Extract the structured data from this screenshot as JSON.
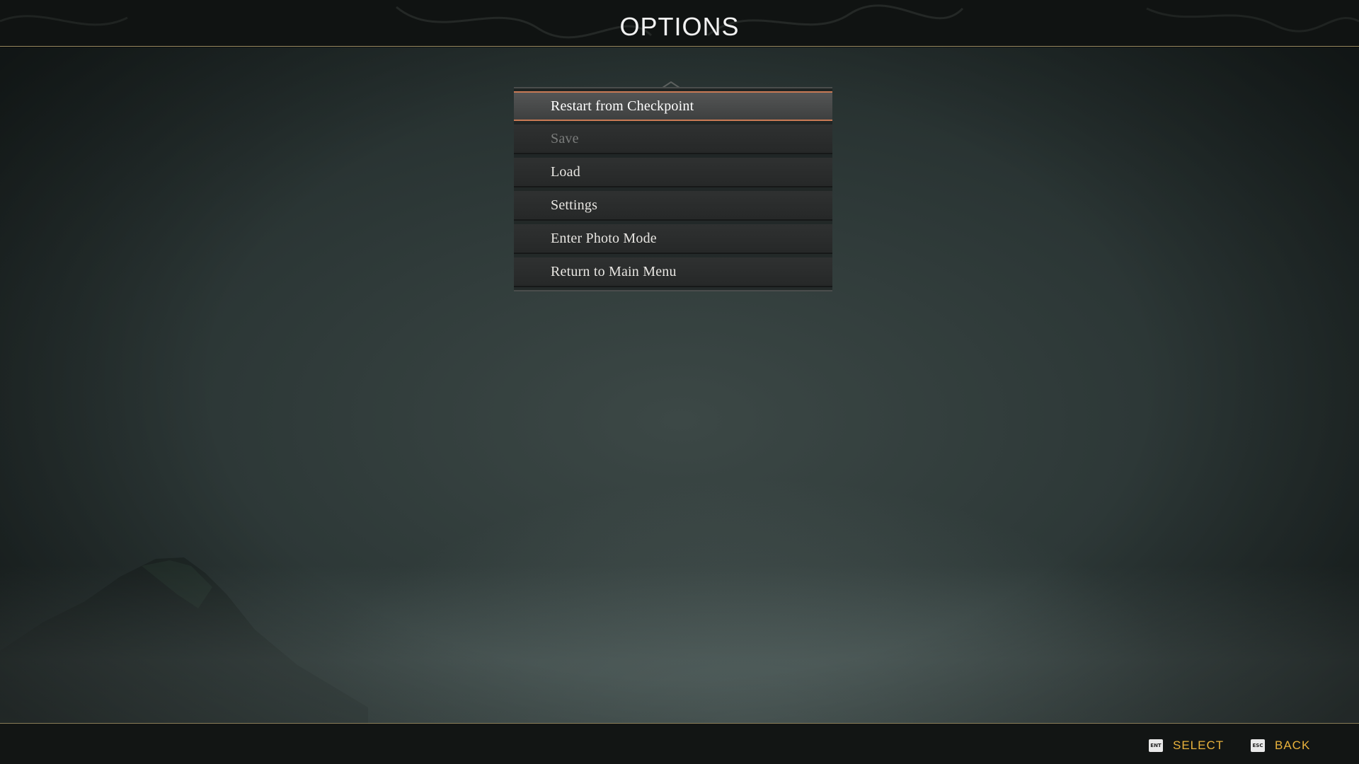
{
  "header": {
    "title": "OPTIONS"
  },
  "menu": {
    "items": [
      {
        "label": "Restart from Checkpoint",
        "state": "selected"
      },
      {
        "label": "Save",
        "state": "disabled"
      },
      {
        "label": "Load",
        "state": "normal"
      },
      {
        "label": "Settings",
        "state": "normal"
      },
      {
        "label": "Enter Photo Mode",
        "state": "normal"
      },
      {
        "label": "Return to Main Menu",
        "state": "normal"
      }
    ]
  },
  "footer": {
    "select": {
      "key": "ENT",
      "label": "SELECT"
    },
    "back": {
      "key": "ESC",
      "label": "BACK"
    }
  },
  "colors": {
    "accent_selected_border": "#c97a55",
    "prompt_text": "#e9b23c",
    "header_rule": "#9a8b62"
  }
}
